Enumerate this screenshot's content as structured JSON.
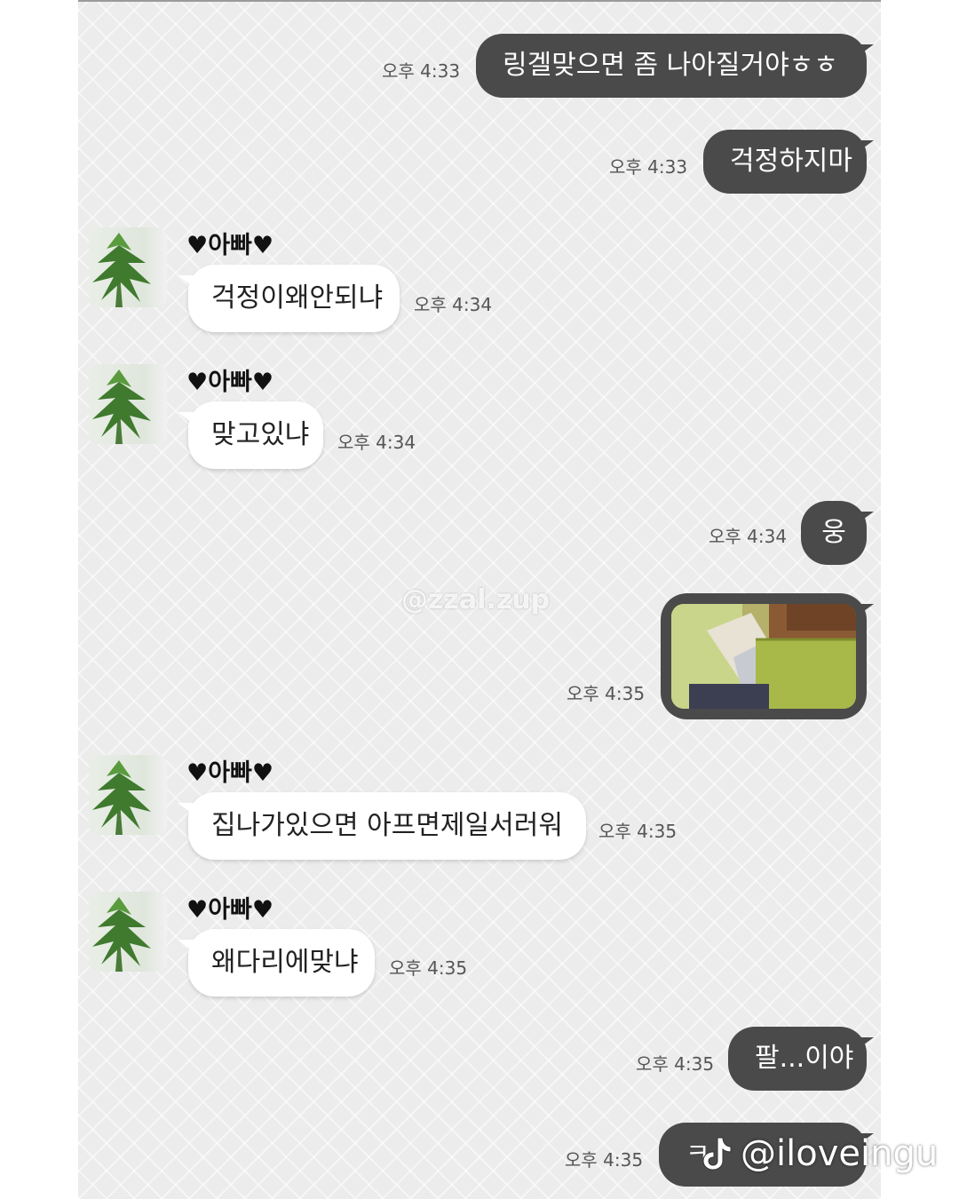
{
  "colors": {
    "outgoing_bubble": "#4a4a4a",
    "incoming_bubble": "#ffffff",
    "chat_background": "#ececec"
  },
  "watermark": "@zzal.zup",
  "tiktok_handle": "@iloveingu",
  "messages": [
    {
      "direction": "out",
      "text": "링겔맞으면 좀 나아질거야ㅎㅎ",
      "time": "오후 4:33"
    },
    {
      "direction": "out",
      "text": "걱정하지마",
      "time": "오후 4:33"
    },
    {
      "direction": "in",
      "sender": "♥아빠♥",
      "text": "걱정이왜안되냐",
      "time": "오후 4:34"
    },
    {
      "direction": "in",
      "sender": "♥아빠♥",
      "text": "맞고있냐",
      "time": "오후 4:34"
    },
    {
      "direction": "out",
      "text": "웅",
      "time": "오후 4:34"
    },
    {
      "direction": "out",
      "type": "photo",
      "time": "오후 4:35"
    },
    {
      "direction": "in",
      "sender": "♥아빠♥",
      "text": "집나가있으면 아프면제일서러워",
      "time": "오후 4:35"
    },
    {
      "direction": "in",
      "sender": "♥아빠♥",
      "text": "왜다리에맞냐",
      "time": "오후 4:35"
    },
    {
      "direction": "out",
      "text": "팔...이야",
      "time": "오후 4:35"
    },
    {
      "direction": "out",
      "text": "ㅋ",
      "time": "오후 4:35"
    }
  ]
}
